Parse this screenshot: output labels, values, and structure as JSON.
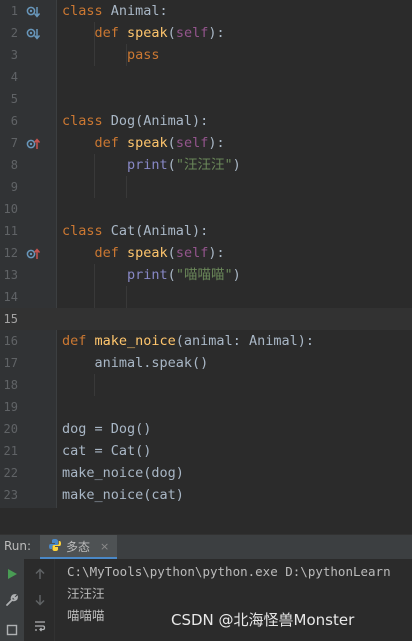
{
  "editor": {
    "lines": [
      {
        "num": "1",
        "tokens": [
          {
            "t": "class ",
            "c": "kw"
          },
          {
            "t": "Animal:",
            "c": ""
          }
        ],
        "icon": "override-down"
      },
      {
        "num": "2",
        "tokens": [
          {
            "t": "    def ",
            "c": "kw"
          },
          {
            "t": "speak",
            "c": "fn"
          },
          {
            "t": "(",
            "c": ""
          },
          {
            "t": "self",
            "c": "self"
          },
          {
            "t": "):",
            "c": ""
          }
        ],
        "icon": "override-down"
      },
      {
        "num": "3",
        "tokens": [
          {
            "t": "        pass",
            "c": "kw"
          }
        ]
      },
      {
        "num": "4",
        "tokens": []
      },
      {
        "num": "5",
        "tokens": []
      },
      {
        "num": "6",
        "tokens": [
          {
            "t": "class ",
            "c": "kw"
          },
          {
            "t": "Dog(Animal):",
            "c": ""
          }
        ]
      },
      {
        "num": "7",
        "tokens": [
          {
            "t": "    def ",
            "c": "kw"
          },
          {
            "t": "speak",
            "c": "fn"
          },
          {
            "t": "(",
            "c": ""
          },
          {
            "t": "self",
            "c": "self"
          },
          {
            "t": "):",
            "c": ""
          }
        ],
        "icon": "override-up"
      },
      {
        "num": "8",
        "tokens": [
          {
            "t": "        ",
            "c": ""
          },
          {
            "t": "print",
            "c": "bi"
          },
          {
            "t": "(",
            "c": ""
          },
          {
            "t": "\"汪汪汪\"",
            "c": "str"
          },
          {
            "t": ")",
            "c": ""
          }
        ]
      },
      {
        "num": "9",
        "tokens": []
      },
      {
        "num": "10",
        "tokens": []
      },
      {
        "num": "11",
        "tokens": [
          {
            "t": "class ",
            "c": "kw"
          },
          {
            "t": "Cat(Animal):",
            "c": ""
          }
        ]
      },
      {
        "num": "12",
        "tokens": [
          {
            "t": "    def ",
            "c": "kw"
          },
          {
            "t": "speak",
            "c": "fn"
          },
          {
            "t": "(",
            "c": ""
          },
          {
            "t": "self",
            "c": "self"
          },
          {
            "t": "):",
            "c": ""
          }
        ],
        "icon": "override-up"
      },
      {
        "num": "13",
        "tokens": [
          {
            "t": "        ",
            "c": ""
          },
          {
            "t": "print",
            "c": "bi"
          },
          {
            "t": "(",
            "c": ""
          },
          {
            "t": "\"喵喵喵\"",
            "c": "str"
          },
          {
            "t": ")",
            "c": ""
          }
        ]
      },
      {
        "num": "14",
        "tokens": []
      },
      {
        "num": "15",
        "tokens": [],
        "current": true
      },
      {
        "num": "16",
        "tokens": [
          {
            "t": "def ",
            "c": "kw"
          },
          {
            "t": "make_noice",
            "c": "fn"
          },
          {
            "t": "(animal: Animal):",
            "c": ""
          }
        ]
      },
      {
        "num": "17",
        "tokens": [
          {
            "t": "    animal.speak()",
            "c": ""
          }
        ]
      },
      {
        "num": "18",
        "tokens": []
      },
      {
        "num": "19",
        "tokens": []
      },
      {
        "num": "20",
        "tokens": [
          {
            "t": "dog = Dog()",
            "c": ""
          }
        ]
      },
      {
        "num": "21",
        "tokens": [
          {
            "t": "cat = Cat()",
            "c": ""
          }
        ]
      },
      {
        "num": "22",
        "tokens": [
          {
            "t": "make_noice(dog)",
            "c": ""
          }
        ]
      },
      {
        "num": "23",
        "tokens": [
          {
            "t": "make_noice(cat)",
            "c": ""
          }
        ]
      }
    ]
  },
  "run_panel": {
    "label": "Run:",
    "tab_label": "多态",
    "tab_close": "×",
    "console_lines": [
      "C:\\MyTools\\python\\python.exe D:\\pythonLearn",
      "汪汪汪",
      "喵喵喵"
    ]
  },
  "watermark": "CSDN @北海怪兽Monster",
  "colors": {
    "keyword": "#cc7832",
    "function": "#ffc66d",
    "self": "#94558d",
    "string": "#6a8759",
    "builtin": "#8888c6",
    "text": "#a9b7c6"
  }
}
